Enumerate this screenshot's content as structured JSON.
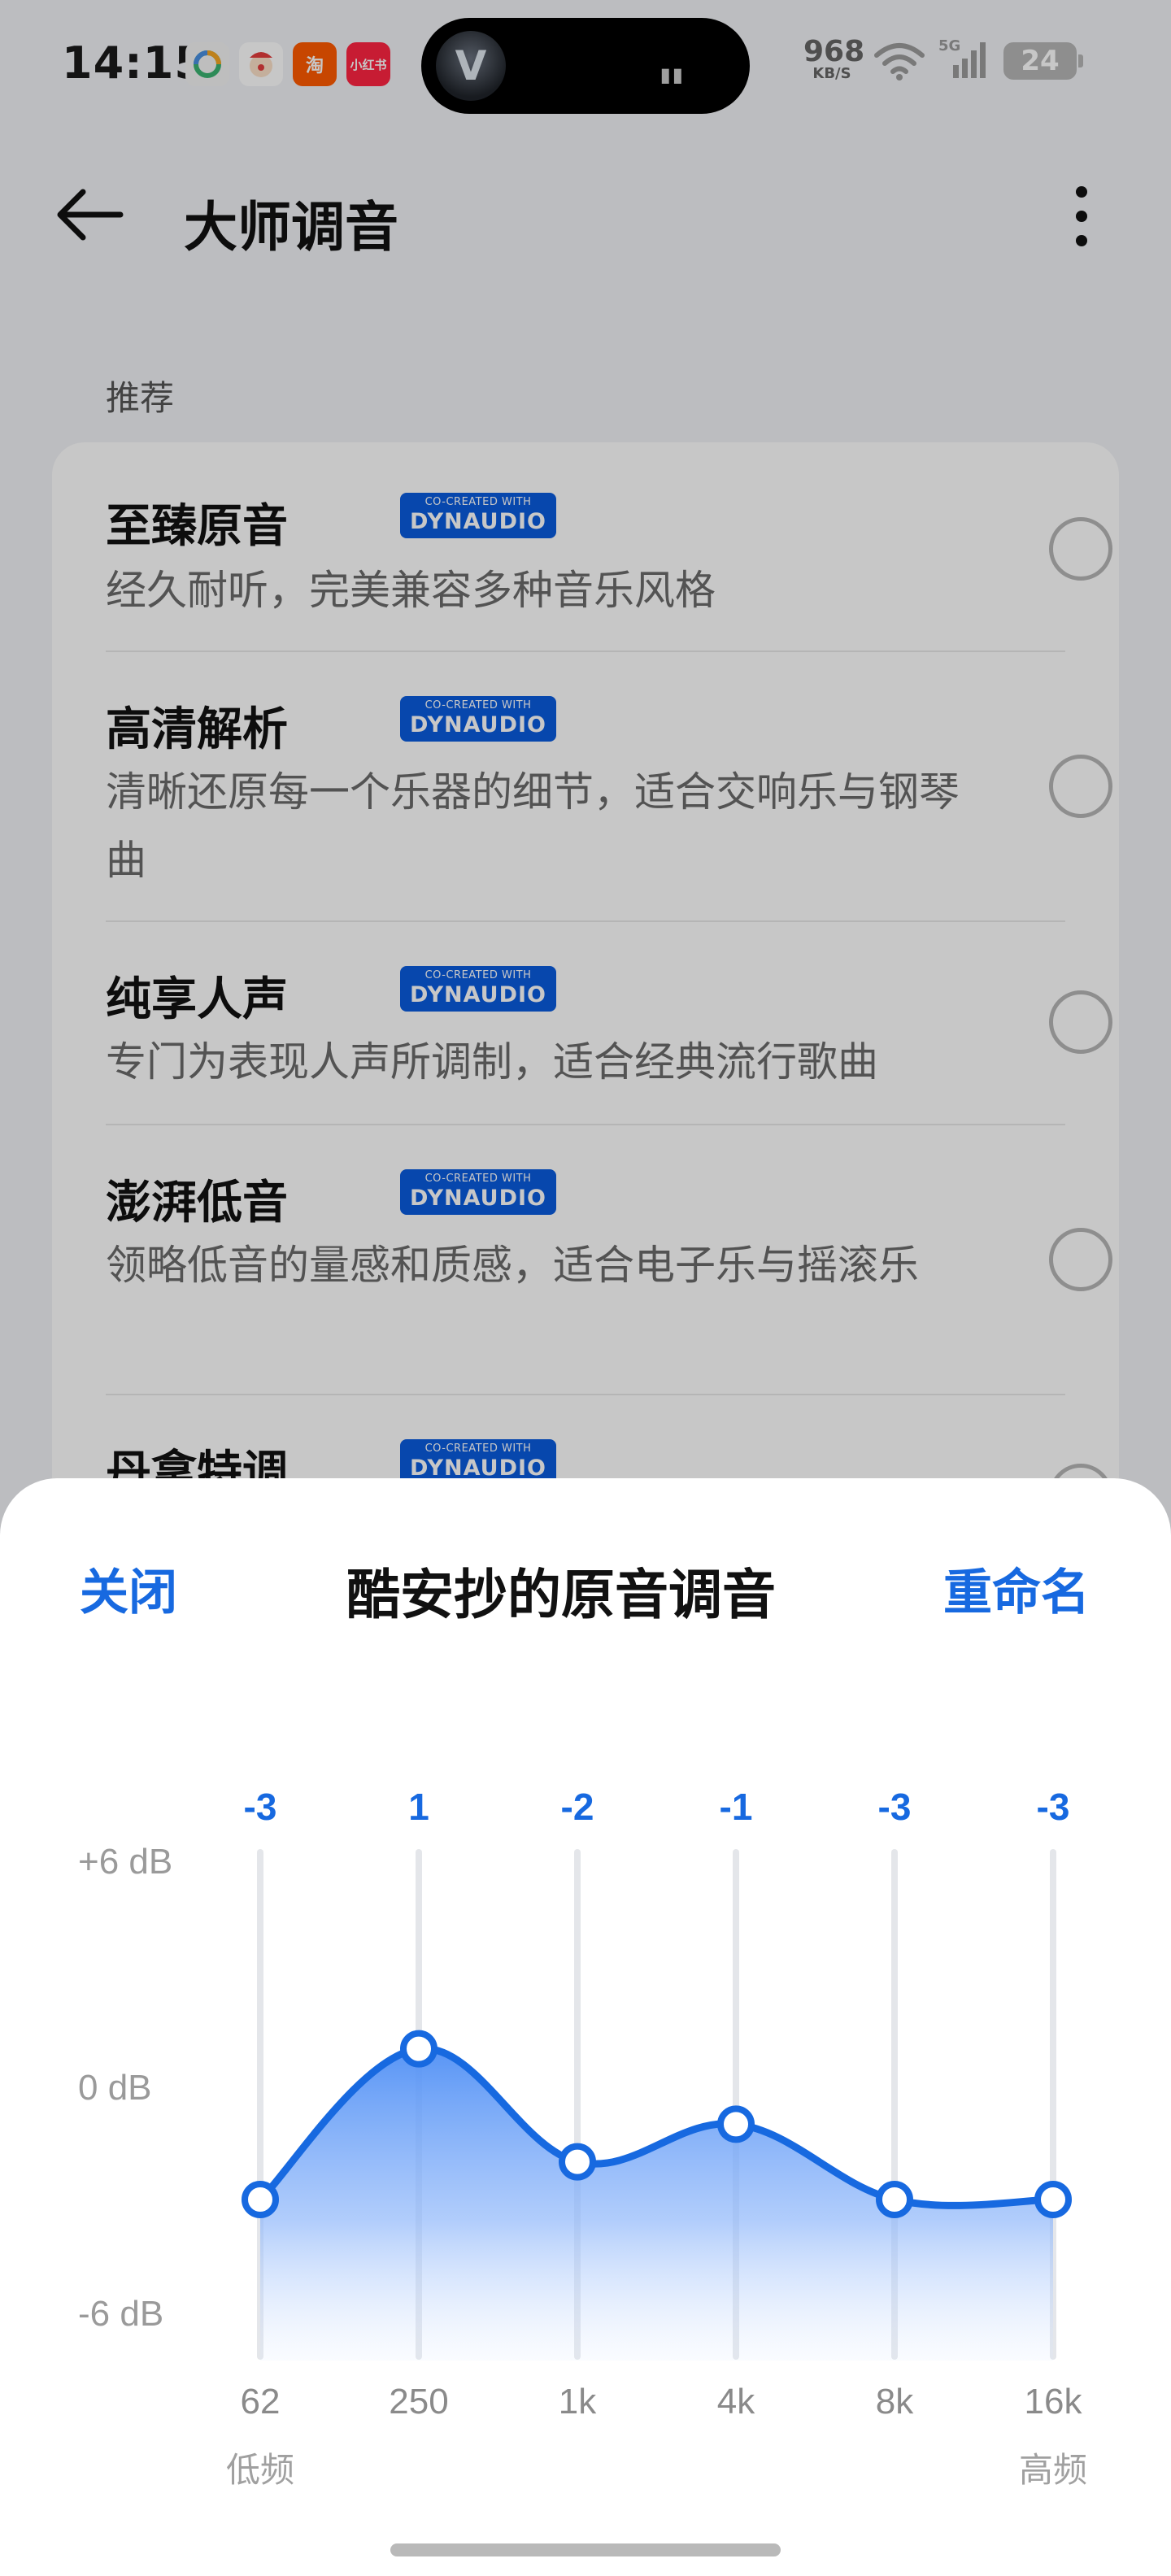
{
  "status_bar": {
    "time": "14:15",
    "app_icons": [
      {
        "name": "pinwheel-app-icon",
        "color": "#f0f0f0",
        "label": ""
      },
      {
        "name": "clown-app-icon",
        "color": "#e33d3d",
        "label": ""
      },
      {
        "name": "taobao-app-icon",
        "color": "#ff5a00",
        "label": "淘"
      },
      {
        "name": "xiaohongshu-app-icon",
        "color": "#ff2442",
        "label": "小红书"
      }
    ],
    "network_speed": "968",
    "network_unit": "KB/S",
    "network_type": "5G",
    "battery": "24"
  },
  "header": {
    "title": "大师调音"
  },
  "recommend_label": "推荐",
  "presets": [
    {
      "name": "至臻原音",
      "desc": "经久耐听，完美兼容多种音乐风格",
      "badge_top": "CO-CREATED WITH",
      "badge_brand": "DYNAUDIO"
    },
    {
      "name": "高清解析",
      "desc": "清晰还原每一个乐器的细节，适合交响乐与钢琴曲",
      "badge_top": "CO-CREATED WITH",
      "badge_brand": "DYNAUDIO"
    },
    {
      "name": "纯享人声",
      "desc": "专门为表现人声所调制，适合经典流行歌曲",
      "badge_top": "CO-CREATED WITH",
      "badge_brand": "DYNAUDIO"
    },
    {
      "name": "澎湃低音",
      "desc": "领略低音的量感和质感，适合电子乐与摇滚乐",
      "badge_top": "CO-CREATED WITH",
      "badge_brand": "DYNAUDIO"
    },
    {
      "name": "丹拿特调",
      "desc": "",
      "badge_top": "CO-CREATED WITH",
      "badge_brand": "DYNAUDIO"
    }
  ],
  "sheet": {
    "close_label": "关闭",
    "title": "酷安抄的原音调音",
    "rename_label": "重命名"
  },
  "chart_data": {
    "type": "line",
    "categories": [
      "62",
      "250",
      "1k",
      "4k",
      "8k",
      "16k"
    ],
    "values": [
      -3,
      1,
      -2,
      -1,
      -3,
      -3
    ],
    "value_labels": [
      "-3",
      "1",
      "-2",
      "-1",
      "-3",
      "-3"
    ],
    "y_tick_labels": [
      "+6 dB",
      "0 dB",
      "-6 dB"
    ],
    "y_ticks": [
      6,
      0,
      -6
    ],
    "ylim": [
      -6,
      6
    ],
    "low_label": "低频",
    "high_label": "高频",
    "accent": "#1769e0"
  }
}
